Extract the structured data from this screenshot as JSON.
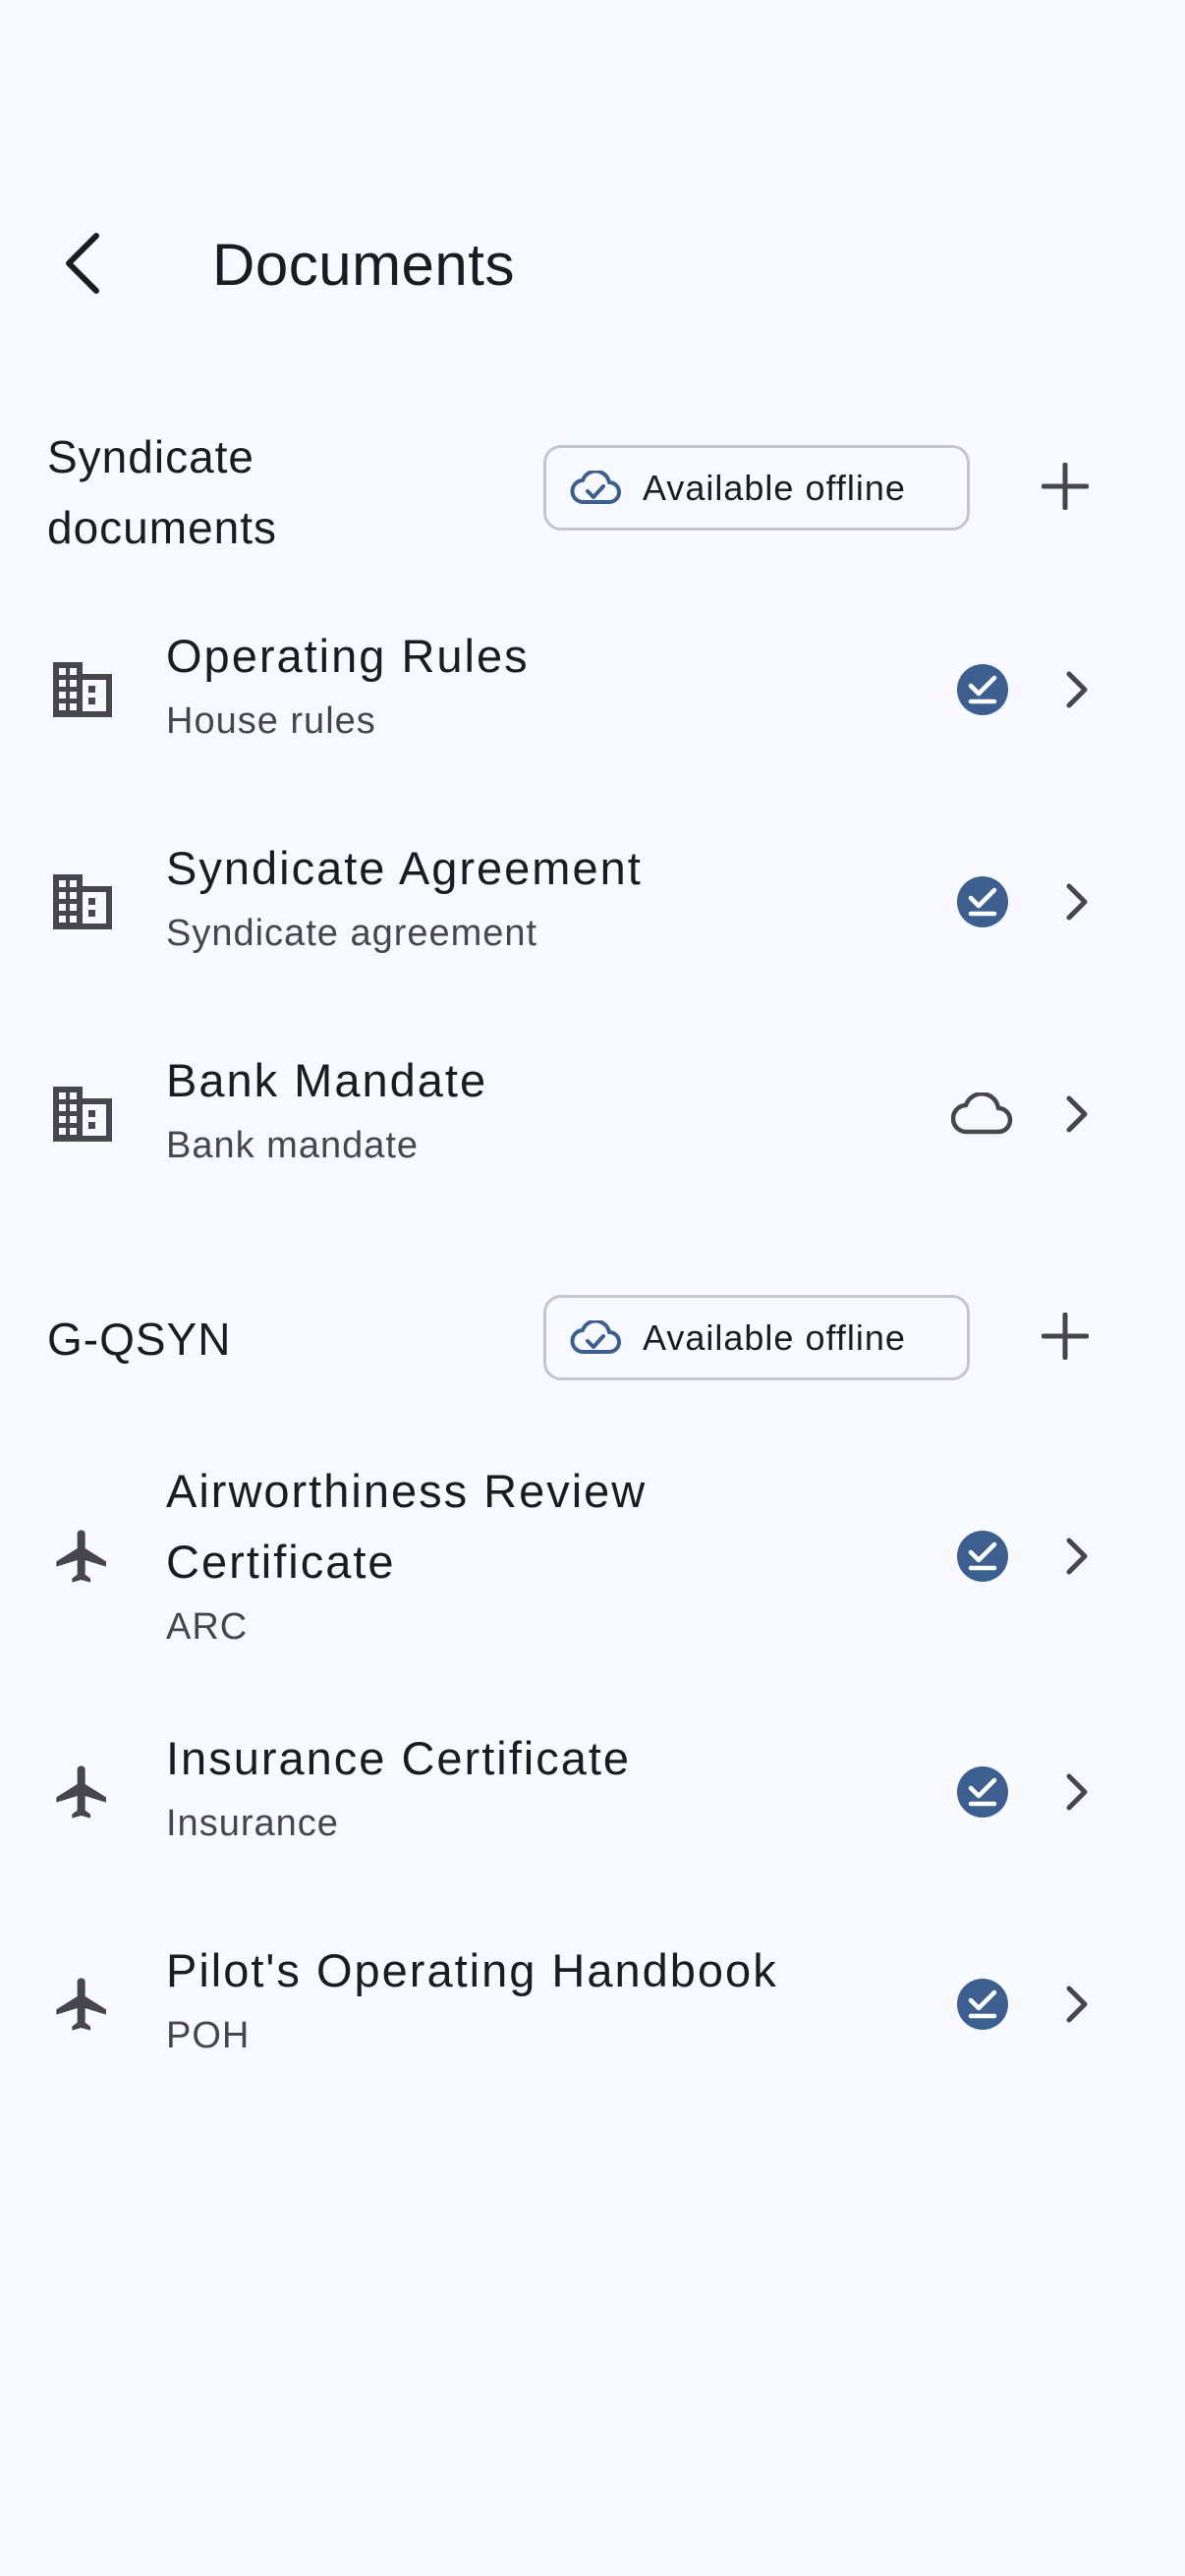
{
  "header": {
    "title": "Documents",
    "back_icon": "arrow-back-icon"
  },
  "sections": [
    {
      "title_line1": "Syndicate",
      "title_line2": "documents",
      "chip_label": "Available offline",
      "chip_icon": "cloud-done-icon",
      "add_icon": "add-icon",
      "items": [
        {
          "title": "Operating Rules",
          "subtitle": "House rules",
          "icon": "building-icon",
          "status": "check-circle-icon"
        },
        {
          "title": "Syndicate Agreement",
          "subtitle": "Syndicate agreement",
          "icon": "building-icon",
          "status": "check-circle-icon"
        },
        {
          "title": "Bank Mandate",
          "subtitle": "Bank mandate",
          "icon": "building-icon",
          "status": "cloud-outline-icon"
        }
      ]
    },
    {
      "title_line1": "G-QSYN",
      "chip_label": "Available offline",
      "chip_icon": "cloud-done-icon",
      "add_icon": "add-icon",
      "items": [
        {
          "title_line1": "Airworthiness Review",
          "title_line2": "Certificate",
          "subtitle": "ARC",
          "icon": "airplane-icon",
          "status": "check-circle-icon"
        },
        {
          "title": "Insurance Certificate",
          "subtitle": "Insurance",
          "icon": "airplane-icon",
          "status": "check-circle-icon"
        },
        {
          "title": "Pilot's Operating Handbook",
          "subtitle": "POH",
          "icon": "airplane-icon",
          "status": "check-circle-icon"
        }
      ]
    }
  ],
  "colors": {
    "background": "#F8F9FE",
    "text_primary": "#1B1C21",
    "text_secondary": "#44474E",
    "icon": "#44474E",
    "accent": "#3D5F8F",
    "chip_border": "#C3C6CF"
  }
}
